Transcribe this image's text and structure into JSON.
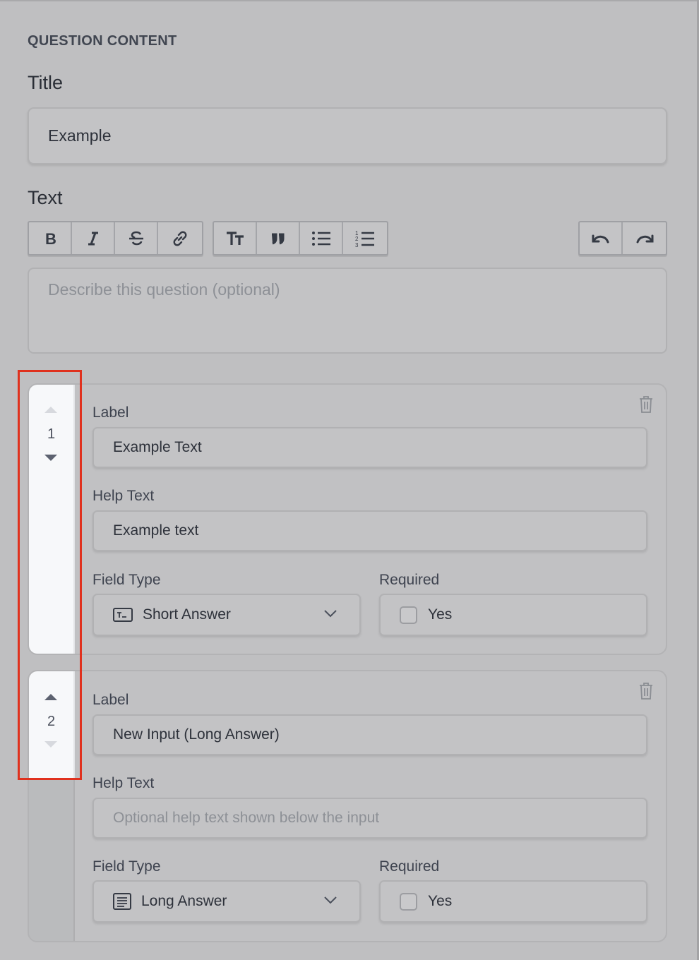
{
  "section_title": "QUESTION CONTENT",
  "title_label": "Title",
  "title_value": "Example",
  "text_label": "Text",
  "toolbar": {
    "format_buttons": [
      "bold-icon",
      "italic-icon",
      "strikethrough-icon",
      "link-icon"
    ],
    "block_buttons": [
      "heading-icon",
      "quote-icon",
      "bullet-list-icon",
      "numbered-list-icon"
    ],
    "history_buttons": [
      "undo-icon",
      "redo-icon"
    ]
  },
  "description_placeholder": "Describe this question (optional)",
  "inputs": [
    {
      "order": "1",
      "label_heading": "Label",
      "label_value": "Example Text",
      "help_heading": "Help Text",
      "help_value": "Example text",
      "help_placeholder": "",
      "type_heading": "Field Type",
      "type_value": "Short Answer",
      "type_icon": "short-answer-icon",
      "required_heading": "Required",
      "required_option": "Yes",
      "required_checked": false
    },
    {
      "order": "2",
      "label_heading": "Label",
      "label_value": "New Input (Long Answer)",
      "help_heading": "Help Text",
      "help_value": "",
      "help_placeholder": "Optional help text shown below the input",
      "type_heading": "Field Type",
      "type_value": "Long Answer",
      "type_icon": "long-answer-icon",
      "required_heading": "Required",
      "required_option": "Yes",
      "required_checked": false
    }
  ],
  "colors": {
    "highlight": "#e0311e",
    "overlay_background": "#bfbfc1"
  }
}
